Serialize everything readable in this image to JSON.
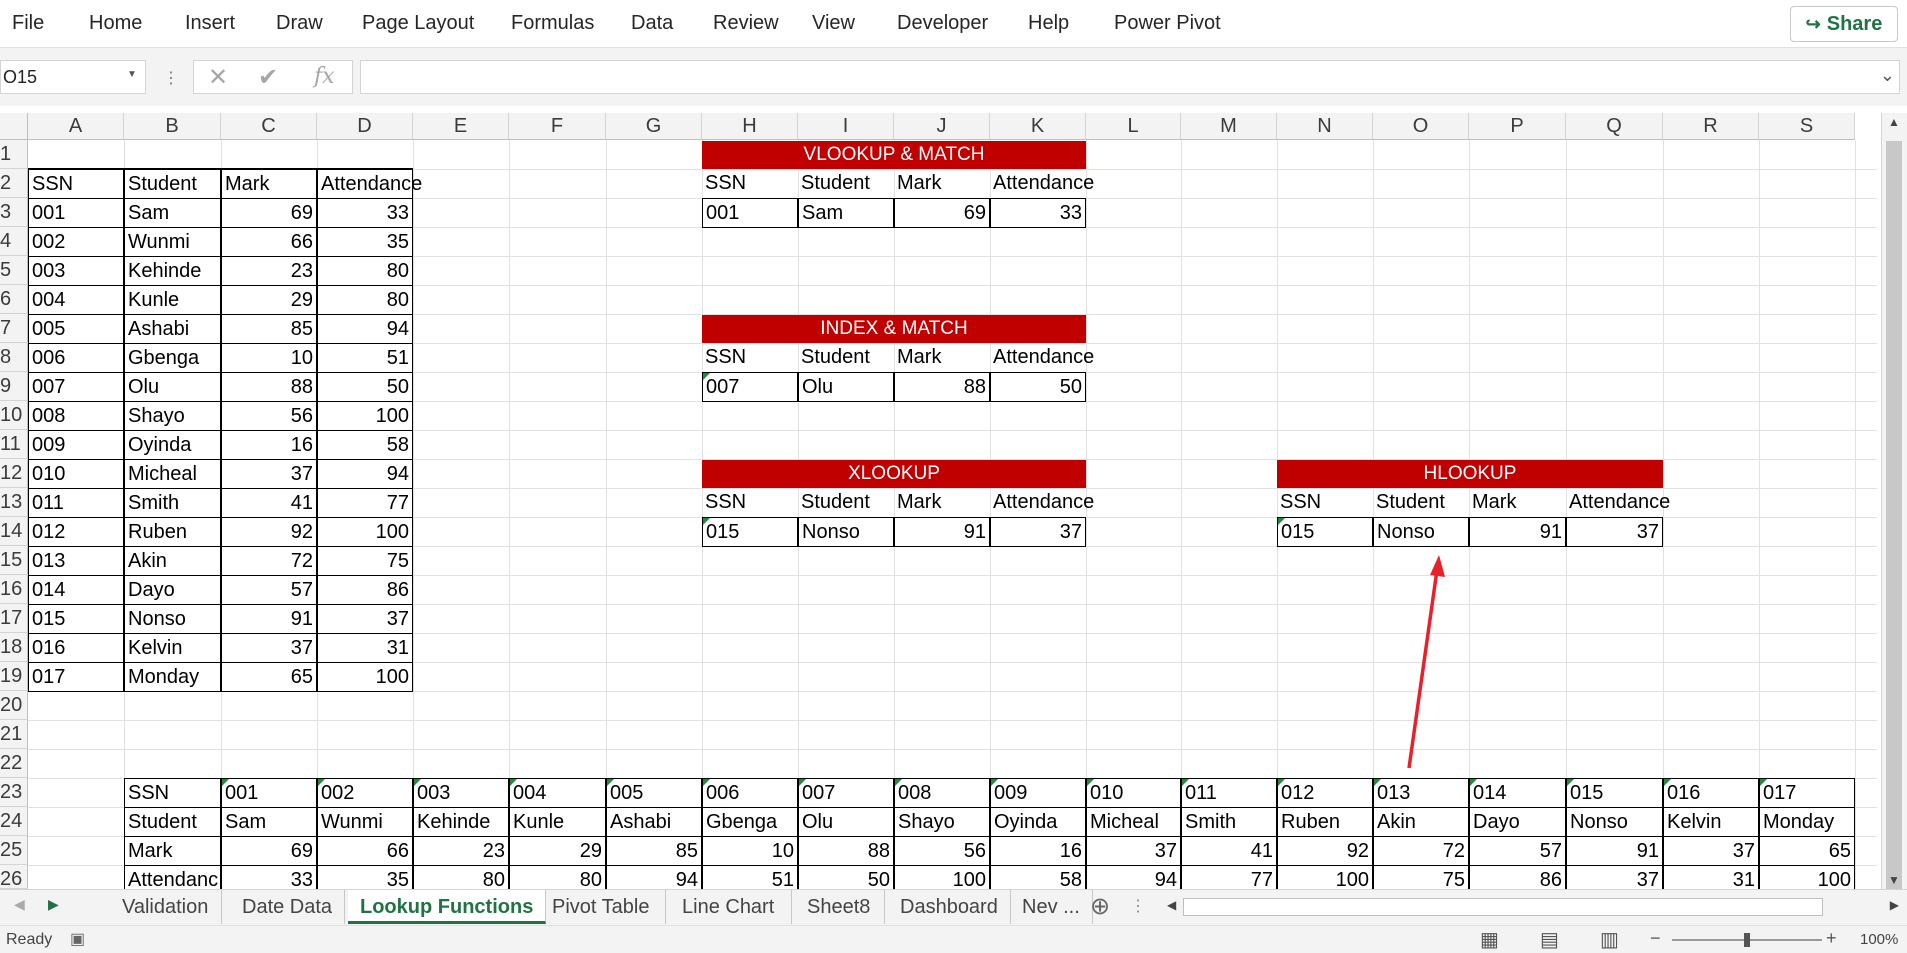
{
  "ribbon": {
    "menu": [
      "File",
      "Home",
      "Insert",
      "Draw",
      "Page Layout",
      "Formulas",
      "Data",
      "Review",
      "View",
      "Developer",
      "Help",
      "Power Pivot"
    ],
    "share_label": "Share"
  },
  "formula_bar": {
    "name_box": "O15",
    "fx_label": "fx",
    "formula": ""
  },
  "columns": [
    "A",
    "B",
    "C",
    "D",
    "E",
    "F",
    "G",
    "H",
    "I",
    "J",
    "K",
    "L",
    "M",
    "N",
    "O",
    "P",
    "Q",
    "R",
    "S"
  ],
  "rows": [
    "1",
    "2",
    "3",
    "4",
    "5",
    "6",
    "7",
    "8",
    "9",
    "10",
    "11",
    "12",
    "13",
    "14",
    "15",
    "16",
    "17",
    "18",
    "19",
    "20",
    "21",
    "22",
    "23",
    "24",
    "25",
    "26"
  ],
  "main_table": {
    "headers": [
      "SSN",
      "Student",
      "Mark",
      "Attendance"
    ],
    "rows": [
      [
        "001",
        "Sam",
        "69",
        "33"
      ],
      [
        "002",
        "Wunmi",
        "66",
        "35"
      ],
      [
        "003",
        "Kehinde",
        "23",
        "80"
      ],
      [
        "004",
        "Kunle",
        "29",
        "80"
      ],
      [
        "005",
        "Ashabi",
        "85",
        "94"
      ],
      [
        "006",
        "Gbenga",
        "10",
        "51"
      ],
      [
        "007",
        "Olu",
        "88",
        "50"
      ],
      [
        "008",
        "Shayo",
        "56",
        "100"
      ],
      [
        "009",
        "Oyinda",
        "16",
        "58"
      ],
      [
        "010",
        "Micheal",
        "37",
        "94"
      ],
      [
        "011",
        "Smith",
        "41",
        "77"
      ],
      [
        "012",
        "Ruben",
        "92",
        "100"
      ],
      [
        "013",
        "Akin",
        "72",
        "75"
      ],
      [
        "014",
        "Dayo",
        "57",
        "86"
      ],
      [
        "015",
        "Nonso",
        "91",
        "37"
      ],
      [
        "016",
        "Kelvin",
        "37",
        "31"
      ],
      [
        "017",
        "Monday",
        "65",
        "100"
      ]
    ]
  },
  "lookups": {
    "vlookup": {
      "title": "VLOOKUP & MATCH",
      "headers": [
        "SSN",
        "Student",
        "Mark",
        "Attendance"
      ],
      "result": [
        "001",
        "Sam",
        "69",
        "33"
      ]
    },
    "index_match": {
      "title": "INDEX & MATCH",
      "headers": [
        "SSN",
        "Student",
        "Mark",
        "Attendance"
      ],
      "result": [
        "007",
        "Olu",
        "88",
        "50"
      ]
    },
    "xlookup": {
      "title": "XLOOKUP",
      "headers": [
        "SSN",
        "Student",
        "Mark",
        "Attendance"
      ],
      "result": [
        "015",
        "Nonso",
        "91",
        "37"
      ]
    },
    "hlookup": {
      "title": "HLOOKUP",
      "headers": [
        "SSN",
        "Student",
        "Mark",
        "Attendance"
      ],
      "result": [
        "015",
        "Nonso",
        "91",
        "37"
      ]
    }
  },
  "horizontal_table": {
    "row_labels": [
      "SSN",
      "Student",
      "Mark",
      "Attendanc"
    ],
    "ssn": [
      "001",
      "002",
      "003",
      "004",
      "005",
      "006",
      "007",
      "008",
      "009",
      "010",
      "011",
      "012",
      "013",
      "014",
      "015",
      "016",
      "017"
    ],
    "student": [
      "Sam",
      "Wunmi",
      "Kehinde",
      "Kunle",
      "Ashabi",
      "Gbenga",
      "Olu",
      "Shayo",
      "Oyinda",
      "Micheal",
      "Smith",
      "Ruben",
      "Akin",
      "Dayo",
      "Nonso",
      "Kelvin",
      "Monday"
    ],
    "mark": [
      "69",
      "66",
      "23",
      "29",
      "85",
      "10",
      "88",
      "56",
      "16",
      "37",
      "41",
      "92",
      "72",
      "57",
      "91",
      "37",
      "65"
    ],
    "attendance": [
      "33",
      "35",
      "80",
      "80",
      "94",
      "51",
      "50",
      "100",
      "58",
      "94",
      "77",
      "100",
      "75",
      "86",
      "37",
      "31",
      "100"
    ]
  },
  "sheet_tabs": [
    "Validation",
    "Date Data",
    "Lookup Functions",
    "Pivot Table",
    "Line Chart",
    "Sheet8",
    "Dashboard",
    "Nev ..."
  ],
  "active_sheet": "Lookup Functions",
  "status": {
    "ready": "Ready",
    "zoom": "100%"
  },
  "colors": {
    "accent": "#217346",
    "banner": "#C00000",
    "arrow": "#E8202A"
  }
}
